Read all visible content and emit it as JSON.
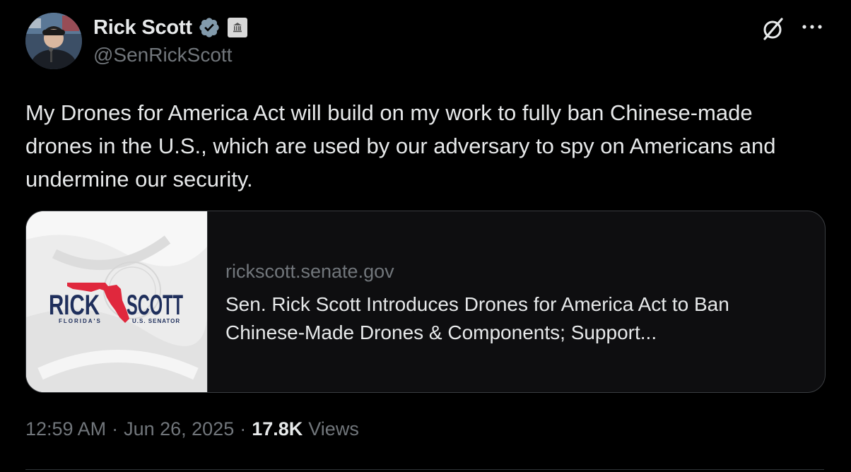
{
  "author": {
    "name": "Rick Scott",
    "handle": "@SenRickScott"
  },
  "icons": {
    "verified": "verified-badge-icon",
    "government": "government-building-icon",
    "grok": "grok-icon",
    "more": "more-icon"
  },
  "tweet": {
    "text": "My Drones for America Act will build on my work to fully ban Chinese-made drones in the U.S., which are used by our adversary to spy on Americans and undermine our security."
  },
  "card": {
    "domain": "rickscott.senate.gov",
    "title": "Sen. Rick Scott Introduces Drones for America Act to Ban Chinese-Made Drones & Components; Support...",
    "logo": {
      "left_word": "RICK",
      "right_word": "SCOTT",
      "left_sub": "FLORIDA'S",
      "right_sub": "U.S. SENATOR"
    }
  },
  "meta": {
    "time": "12:59 AM",
    "date": "Jun 26, 2025",
    "separator": "·",
    "views_count": "17.8K",
    "views_label": "Views"
  },
  "colors": {
    "background": "#000000",
    "text": "#e7e9ea",
    "muted": "#71767b",
    "verified": "#829aab",
    "logo_blue": "#1f2f5c",
    "logo_red": "#e0283d"
  }
}
